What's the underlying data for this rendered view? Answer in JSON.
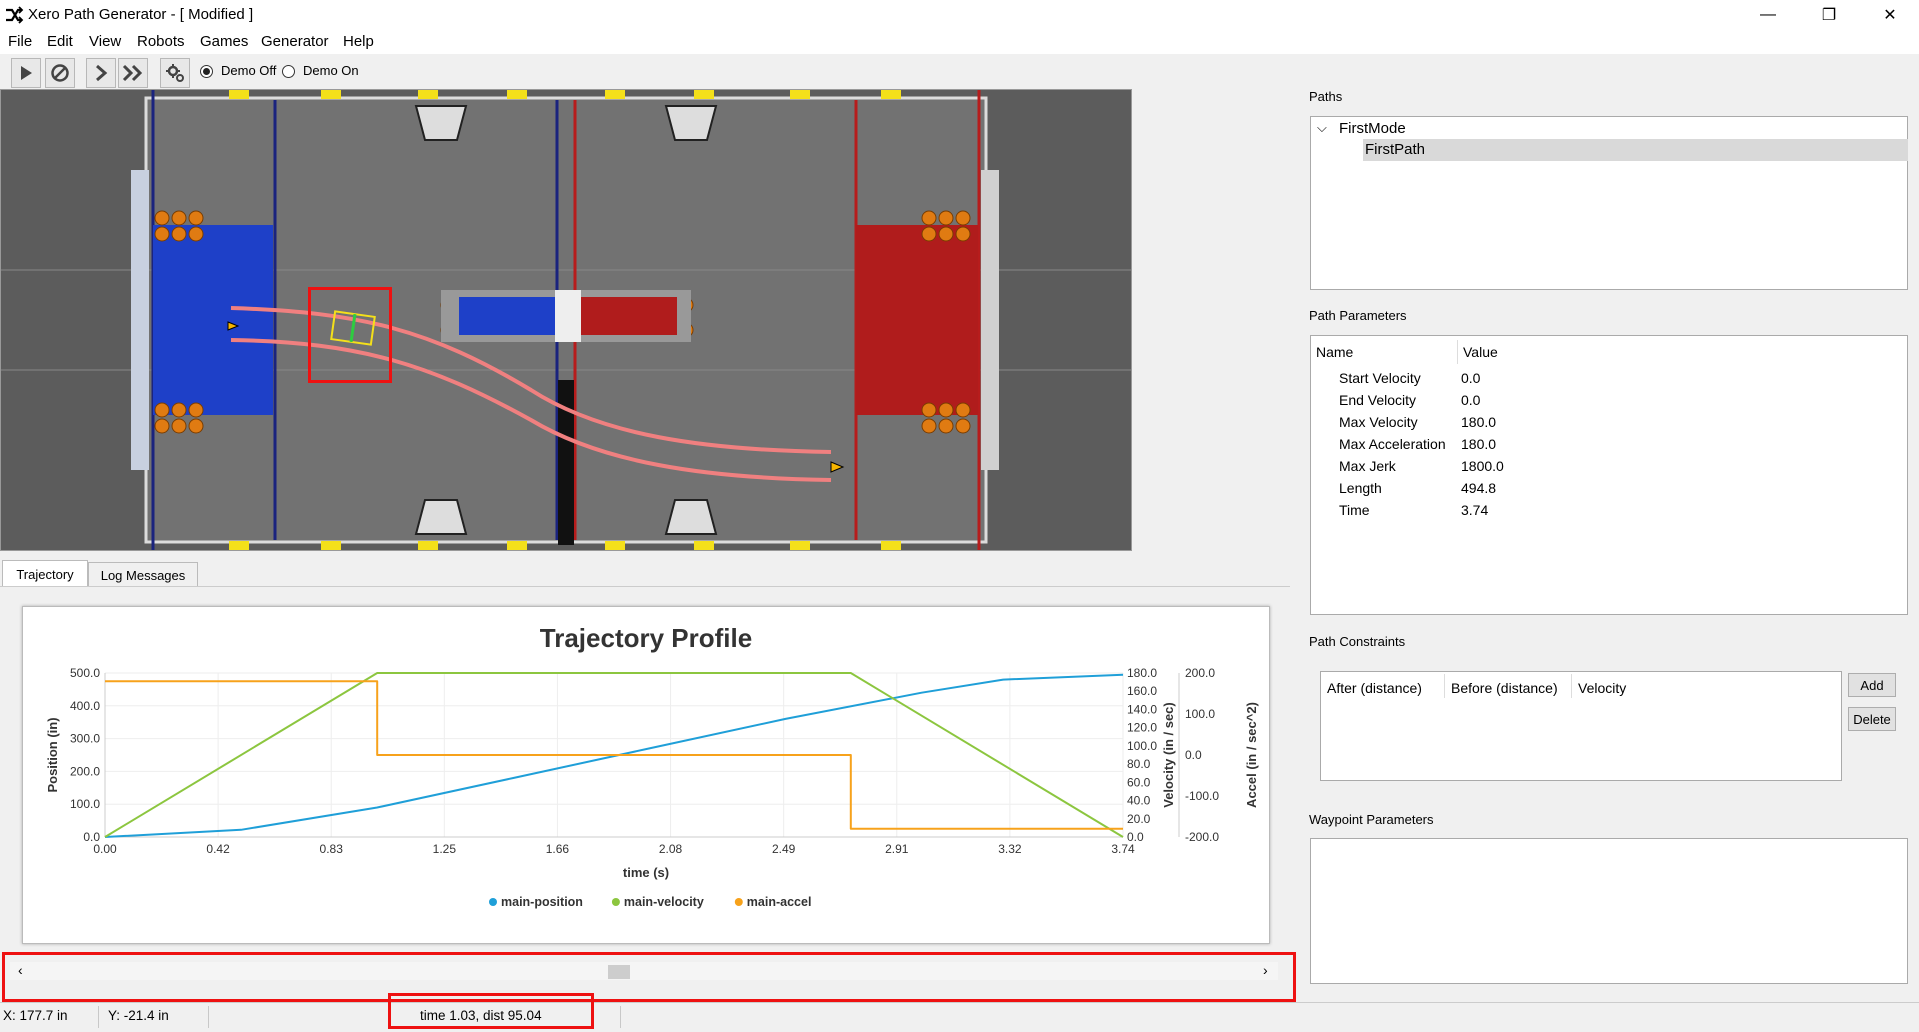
{
  "window": {
    "title": "Xero Path Generator -  [ Modified ]",
    "minimize": "—",
    "maximize": "❐",
    "close": "✕"
  },
  "menu": [
    "File",
    "Edit",
    "View",
    "Robots",
    "Games",
    "Generator",
    "Help"
  ],
  "toolbar": {
    "buttons": [
      "play-icon",
      "stop-icon",
      "step-icon",
      "fast-forward-icon",
      "settings-icon"
    ],
    "demo_off": "Demo Off",
    "demo_on": "Demo On",
    "demo_selected": "Demo Off"
  },
  "tabs": {
    "trajectory": "Trajectory",
    "log": "Log Messages",
    "active": "Trajectory"
  },
  "chart_data": {
    "type": "line",
    "title": "Trajectory Profile",
    "xlabel": "time (s)",
    "x_ticks": [
      "0.00",
      "0.42",
      "0.83",
      "1.25",
      "1.66",
      "2.08",
      "2.49",
      "2.91",
      "3.32",
      "3.74"
    ],
    "xlim": [
      0,
      3.74
    ],
    "y_axes": [
      {
        "label": "Position (in)",
        "ticks": [
          "0.0",
          "100.0",
          "200.0",
          "300.0",
          "400.0",
          "500.0"
        ],
        "ylim": [
          0,
          500
        ]
      },
      {
        "label": "Velocity (in / sec)",
        "ticks": [
          "0.0",
          "20.0",
          "40.0",
          "60.0",
          "80.0",
          "100.0",
          "120.0",
          "140.0",
          "160.0",
          "180.0"
        ],
        "ylim": [
          0,
          180
        ]
      },
      {
        "label": "Accel (in / sec^2)",
        "ticks": [
          "-200.0",
          "-100.0",
          "0.0",
          "100.0",
          "200.0"
        ],
        "ylim": [
          -200,
          200
        ]
      }
    ],
    "series": [
      {
        "name": "main-position",
        "color": "#1f9fd8",
        "x": [
          0,
          0.5,
          1.0,
          1.5,
          2.0,
          2.5,
          3.0,
          3.3,
          3.74
        ],
        "y": [
          0,
          22,
          90,
          180,
          270,
          360,
          440,
          480,
          494.8
        ]
      },
      {
        "name": "main-velocity",
        "color": "#8cc63f",
        "x": [
          0,
          1.0,
          2.74,
          3.74
        ],
        "y": [
          0,
          180,
          180,
          0
        ]
      },
      {
        "name": "main-accel",
        "color": "#f7a21b",
        "x": [
          0,
          1.0,
          1.0,
          2.74,
          2.74,
          3.74
        ],
        "y": [
          180,
          180,
          0,
          0,
          -180,
          -180
        ]
      }
    ],
    "legend_position": "bottom",
    "grid": true
  },
  "status": {
    "x": "X: 177.7 in",
    "y": "Y: -21.4 in",
    "time": "time 1.03, dist 95.04"
  },
  "paths": {
    "label": "Paths",
    "group": "FirstMode",
    "selected": "FirstPath"
  },
  "path_params": {
    "label": "Path Parameters",
    "headers": [
      "Name",
      "Value"
    ],
    "rows": [
      [
        "Start Velocity",
        "0.0"
      ],
      [
        "End Velocity",
        "0.0"
      ],
      [
        "Max Velocity",
        "180.0"
      ],
      [
        "Max Acceleration",
        "180.0"
      ],
      [
        "Max Jerk",
        "1800.0"
      ],
      [
        "Length",
        "494.8"
      ],
      [
        "Time",
        "3.74"
      ]
    ]
  },
  "constraints": {
    "label": "Path Constraints",
    "headers": [
      "After (distance)",
      "Before (distance)",
      "Velocity"
    ],
    "add": "Add",
    "delete": "Delete"
  },
  "waypoint": {
    "label": "Waypoint Parameters"
  }
}
